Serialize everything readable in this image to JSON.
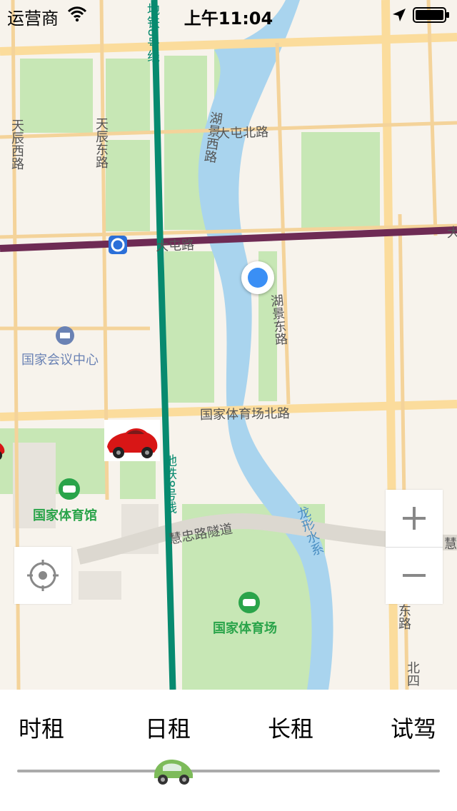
{
  "status_bar": {
    "carrier": "运营商",
    "time": "上午11:04"
  },
  "map": {
    "road_labels": {
      "datun_bei": "大屯北路",
      "datun": "大屯路",
      "datun_edge": "大",
      "guojia_tiyuchang_bei": "国家体育场北路",
      "huizhong_tunnel": "慧忠路隧道",
      "hui_edge": "慧",
      "tianchen_xi": "天辰西路",
      "tianchen_dong": "天辰东路",
      "hujing_xi": "湖景西路",
      "hujing_dong": "湖景东路",
      "subway_top": "地铁8号线",
      "subway_mid": "地铁8号线",
      "longxing": "龙形水系",
      "dong_edge": "东路",
      "beisi_edge": "北四"
    },
    "pois": {
      "convention_center": "国家会议中心",
      "gymnasium": "国家体育馆",
      "stadium": "国家体育场"
    },
    "colors": {
      "water": "#a9d4ee",
      "park": "#c7e7b5",
      "road_major": "#fbdc9c",
      "subway_8": "#078a6f",
      "subway_15": "#6e2b54",
      "poi_green": "#2aa44a",
      "poi_blue": "#6a82b4"
    }
  },
  "controls": {
    "zoom_in": "+",
    "zoom_out": "−"
  },
  "tabs": [
    {
      "label": "时租"
    },
    {
      "label": "日租"
    },
    {
      "label": "长租"
    },
    {
      "label": "试驾"
    }
  ],
  "slider": {
    "selected_index": 1
  }
}
